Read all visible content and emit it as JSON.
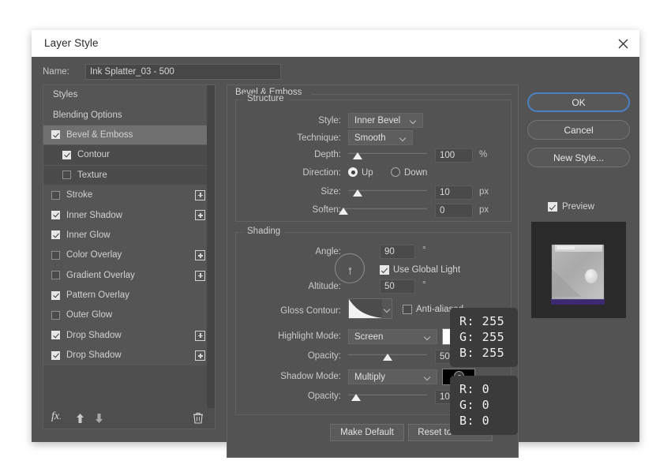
{
  "window": {
    "title": "Layer Style",
    "close_icon": "close-icon"
  },
  "name_field": {
    "label": "Name:",
    "value": "Ink Splatter_03 - 500"
  },
  "styles_list": {
    "items": [
      {
        "label": "Styles",
        "checkbox": "none",
        "level": 0,
        "plus": false,
        "selected": false
      },
      {
        "label": "Blending Options",
        "checkbox": "none",
        "level": 0,
        "plus": false,
        "selected": false
      },
      {
        "label": "Bevel & Emboss",
        "checkbox": "on",
        "level": 0,
        "plus": false,
        "selected": true
      },
      {
        "label": "Contour",
        "checkbox": "on",
        "level": 1,
        "plus": false,
        "selected": false
      },
      {
        "label": "Texture",
        "checkbox": "off",
        "level": 1,
        "plus": false,
        "selected": false
      },
      {
        "label": "Stroke",
        "checkbox": "off",
        "level": 0,
        "plus": true,
        "selected": false
      },
      {
        "label": "Inner Shadow",
        "checkbox": "on",
        "level": 0,
        "plus": true,
        "selected": false
      },
      {
        "label": "Inner Glow",
        "checkbox": "on",
        "level": 0,
        "plus": false,
        "selected": false
      },
      {
        "label": "Color Overlay",
        "checkbox": "off",
        "level": 0,
        "plus": true,
        "selected": false
      },
      {
        "label": "Gradient Overlay",
        "checkbox": "off",
        "level": 0,
        "plus": true,
        "selected": false
      },
      {
        "label": "Pattern Overlay",
        "checkbox": "on",
        "level": 0,
        "plus": false,
        "selected": false
      },
      {
        "label": "Outer Glow",
        "checkbox": "off",
        "level": 0,
        "plus": false,
        "selected": false
      },
      {
        "label": "Drop Shadow",
        "checkbox": "on",
        "level": 0,
        "plus": true,
        "selected": false
      },
      {
        "label": "Drop Shadow",
        "checkbox": "on",
        "level": 0,
        "plus": true,
        "selected": false
      }
    ],
    "footer": {
      "fx_icon": "fx-icon",
      "move_up_icon": "arrow-up-icon",
      "move_down_icon": "arrow-down-icon",
      "delete_icon": "trash-icon"
    }
  },
  "panel": {
    "title": "Bevel & Emboss",
    "structure": {
      "title": "Structure",
      "style": {
        "label": "Style:",
        "value": "Inner Bevel"
      },
      "technique": {
        "label": "Technique:",
        "value": "Smooth"
      },
      "depth": {
        "label": "Depth:",
        "value": "100",
        "unit": "%",
        "slider_pct": 12
      },
      "direction": {
        "label": "Direction:",
        "up_label": "Up",
        "down_label": "Down",
        "selected": "Up"
      },
      "size": {
        "label": "Size:",
        "value": "10",
        "unit": "px",
        "slider_pct": 12
      },
      "soften": {
        "label": "Soften:",
        "value": "0",
        "unit": "px",
        "slider_pct": 2
      }
    },
    "shading": {
      "title": "Shading",
      "angle": {
        "label": "Angle:",
        "value": "90",
        "unit": "°"
      },
      "use_global_light": {
        "label": "Use Global Light",
        "checked": true
      },
      "altitude": {
        "label": "Altitude:",
        "value": "50",
        "unit": "°"
      },
      "gloss_contour": {
        "label": "Gloss Contour:"
      },
      "anti_aliased": {
        "label": "Anti-aliased",
        "checked": false
      },
      "highlight_mode": {
        "label": "Highlight Mode:",
        "value": "Screen",
        "color": "#ffffff"
      },
      "highlight_opacity": {
        "label": "Opacity:",
        "value": "50",
        "unit": "%",
        "slider_pct": 50
      },
      "shadow_mode": {
        "label": "Shadow Mode:",
        "value": "Multiply",
        "color": "#000000"
      },
      "shadow_opacity": {
        "label": "Opacity:",
        "value": "10",
        "unit": "%",
        "slider_pct": 10
      }
    },
    "tooltips": {
      "highlight_rgb": "R: 255\nG: 255\nB: 255",
      "shadow_rgb": "R: 0\nG: 0\nB: 0"
    },
    "buttons": {
      "make_default": "Make Default",
      "reset_to_default": "Reset to Default"
    }
  },
  "right_panel": {
    "ok": "OK",
    "cancel": "Cancel",
    "new_style": "New Style...",
    "preview": {
      "label": "Preview",
      "checked": true
    }
  },
  "colors": {
    "accent": "#4a7fc1",
    "dialog_bg": "#535353",
    "list_bg": "#4e4e4e",
    "selected_row": "#707070",
    "tooltip_bg": "#3b3b3b",
    "preview_bg": "#2a2a2a",
    "preview_shadow": "#3b2a72"
  }
}
